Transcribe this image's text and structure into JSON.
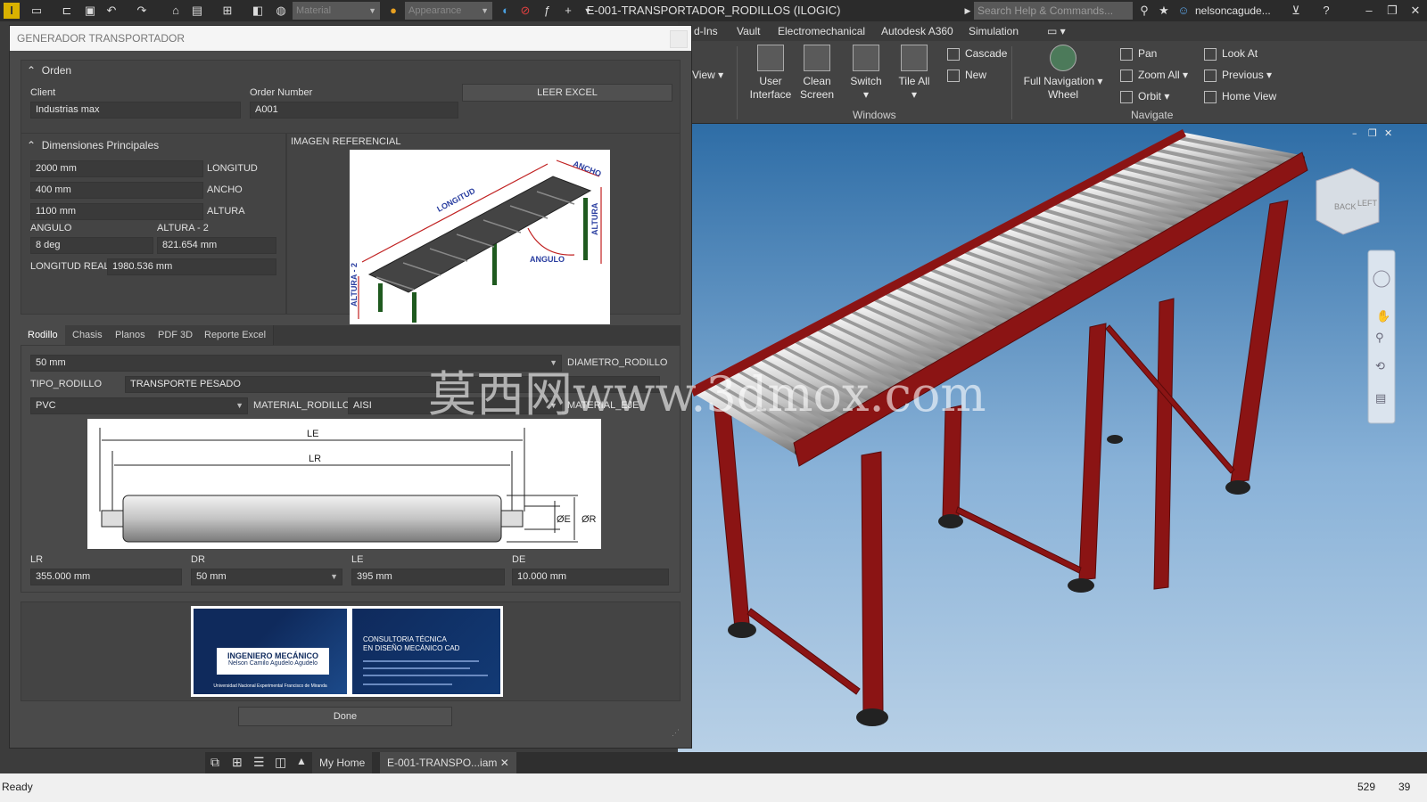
{
  "app": {
    "title": "E-001-TRANSPORTADOR_RODILLOS (ILOGIC)",
    "search_placeholder": "Search Help & Commands...",
    "user": "nelsoncagude...",
    "combo1": "Material",
    "combo2": "Appearance"
  },
  "ribbon": {
    "tabs": [
      "d-Ins",
      "Vault",
      "Electromechanical",
      "Autodesk A360",
      "Simulation"
    ],
    "view_partial": "n View",
    "user_interface": [
      "User",
      "Interface"
    ],
    "clean_screen": [
      "Clean",
      "Screen"
    ],
    "switch": "Switch",
    "tile_all": "Tile All",
    "cascade": "Cascade",
    "new": "New",
    "windows_label": "Windows",
    "full_nav": [
      "Full Navigation",
      "Wheel"
    ],
    "pan": "Pan",
    "zoom_all": "Zoom All",
    "orbit": "Orbit",
    "look_at": "Look At",
    "previous": "Previous",
    "home_view": "Home View",
    "navigate_label": "Navigate"
  },
  "dialog": {
    "title": "GENERADOR TRANSPORTADOR",
    "orden": {
      "header": "Orden",
      "client_label": "Client",
      "client_value": "Industrias max",
      "order_label": "Order Number",
      "order_value": "A001",
      "leer_excel": "LEER EXCEL"
    },
    "dimensiones": {
      "header": "Dimensiones Principales",
      "longitud_value": "2000 mm",
      "longitud_label": "LONGITUD",
      "ancho_value": "400 mm",
      "ancho_label": "ANCHO",
      "altura_value": "1100 mm",
      "altura_label": "ALTURA",
      "angulo_label": "ANGULO",
      "angulo_value": "8 deg",
      "altura2_label": "ALTURA - 2",
      "altura2_value": "821.654 mm",
      "longreal_label": "LONGITUD REAL",
      "longreal_value": "1980.536 mm"
    },
    "imagen": {
      "header": "IMAGEN REFERENCIAL",
      "labels": {
        "longitud": "LONGITUD",
        "ancho": "ANCHO",
        "altura": "ALTURA",
        "angulo": "ANGULO",
        "altura2": "ALTURA - 2"
      }
    },
    "tabs": [
      "Rodillo",
      "Chasis",
      "Planos",
      "PDF 3D",
      "Reporte Excel"
    ],
    "rodillo": {
      "diametro_value": "50 mm",
      "diametro_label": "DIAMETRO_RODILLO",
      "tipo_label": "TIPO_RODILLO",
      "tipo_value": "TRANSPORTE PESADO",
      "material_value": "PVC",
      "material_label": "MATERIAL_RODILLO",
      "eje_value": "AISI",
      "eje_label": "MATERIAL_EJE",
      "drawing": {
        "le": "LE",
        "lr": "LR",
        "oe": "ØE",
        "or": "ØR"
      },
      "lr_label": "LR",
      "lr_value": "355.000 mm",
      "dr_label": "DR",
      "dr_value": "50 mm",
      "le_label": "LE",
      "le_value": "395 mm",
      "de_label": "DE",
      "de_value": "10.000 mm"
    },
    "card": {
      "title": "INGENIERO MECÁNICO",
      "name": "Nelson Camilo Agudelo Agudelo",
      "university": "Universidad Nacional Experimental Francisco de Miranda",
      "right_line1": "CONSULTORIA TÉCNICA",
      "right_line2": "EN DISEÑO MECÁNICO CAD"
    },
    "done": "Done"
  },
  "watermark": "莫西网www.3dmox.com",
  "doc_tabs": {
    "home": "My Home",
    "doc": "E-001-TRANSPO...iam"
  },
  "status": {
    "text": "Ready",
    "n1": "529",
    "n2": "39"
  },
  "colors": {
    "frame_red": "#8b1414",
    "roller": "#c9c9c9",
    "sky_top": "#2e6da6",
    "card_blue": "#0f2a5c"
  }
}
